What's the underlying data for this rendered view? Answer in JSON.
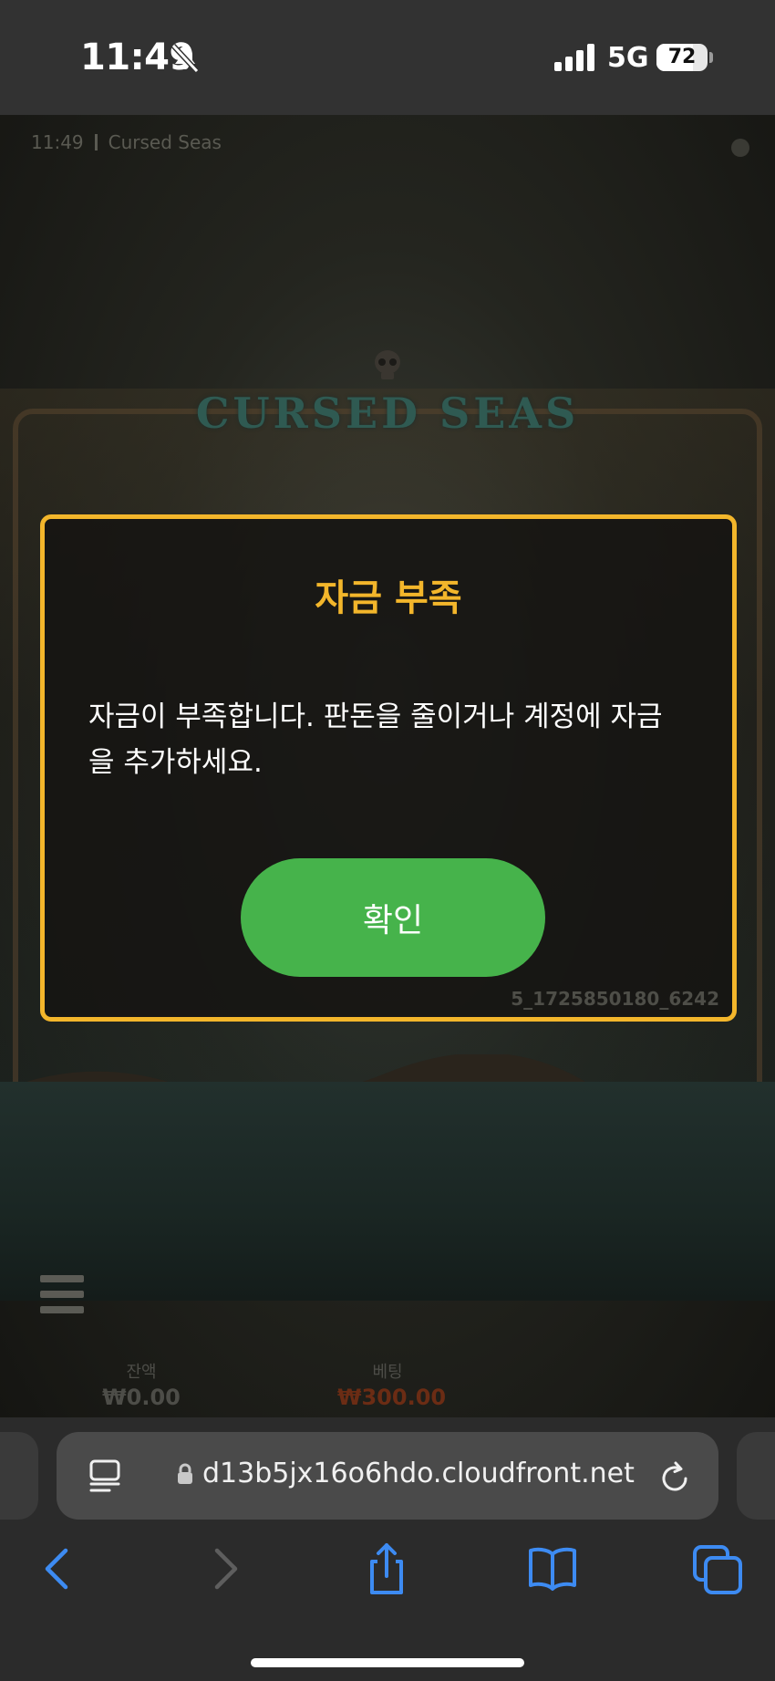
{
  "status_bar": {
    "time": "11:49",
    "network": "5G",
    "battery_level": "72",
    "battery_fraction": 0.72,
    "icons": [
      "bell-slash-icon",
      "signal-icon",
      "battery-icon"
    ]
  },
  "game": {
    "topbar_time": "11:49",
    "topbar_title": "Cursed Seas",
    "logo_text": "CURSED SEAS",
    "balance_label": "잔액",
    "balance_value": "₩0.00",
    "bet_label": "베팅",
    "bet_value": "₩300.00",
    "colors": {
      "balance": "#4d4d48",
      "bet": "#6b2c14"
    }
  },
  "dialog": {
    "title": "자금 부족",
    "message_line1": "자금이 부족합니다. 판돈을 줄이거나 계정에 자금",
    "message_line2": "을 추가하세요.",
    "confirm_label": "확인",
    "error_code": "5_1725850180_6242",
    "colors": {
      "border": "#f3b62b",
      "title": "#f3b62b",
      "button": "#46b34b"
    }
  },
  "browser": {
    "url": "d13b5jx16o6hdo.cloudfront.net",
    "icons": [
      "reader-icon",
      "lock-icon",
      "reload-icon",
      "back-icon",
      "forward-icon",
      "share-icon",
      "bookmarks-icon",
      "tabs-icon"
    ],
    "accent": "#3d8bf2"
  }
}
